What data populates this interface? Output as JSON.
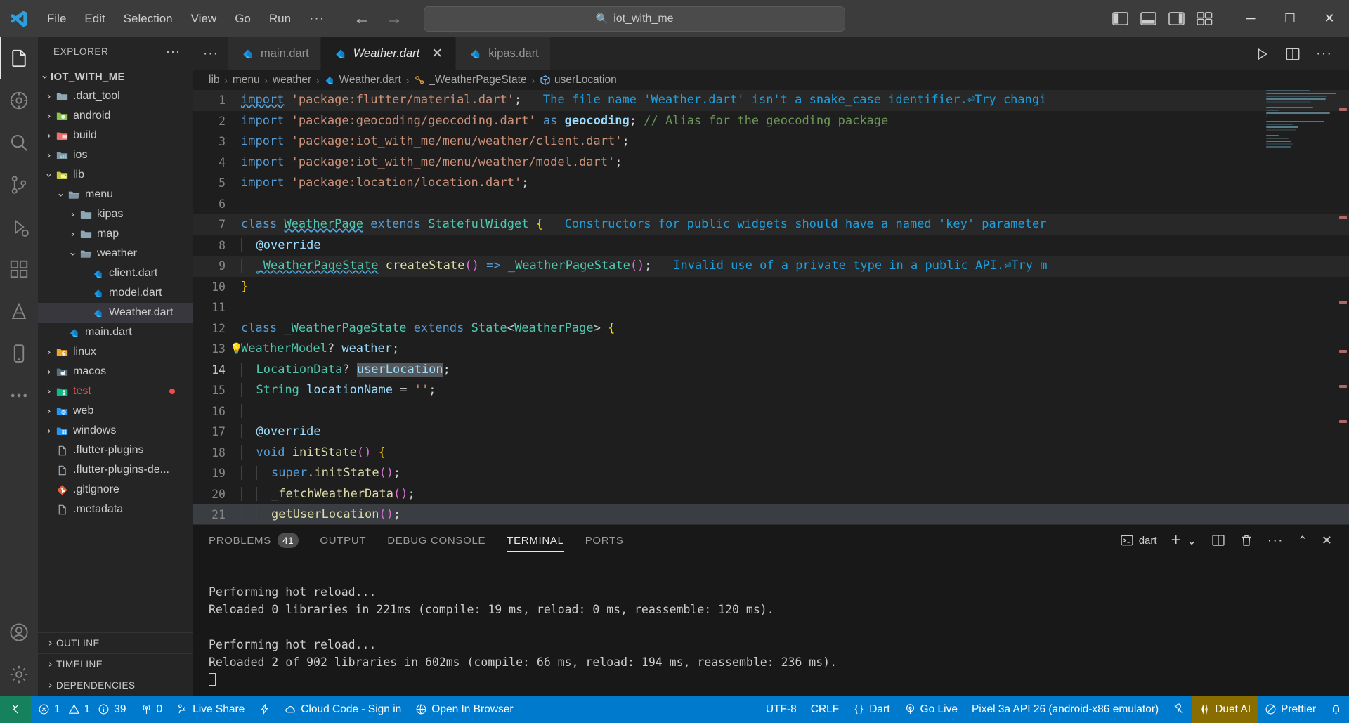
{
  "titlebar": {
    "menus": [
      "File",
      "Edit",
      "Selection",
      "View",
      "Go",
      "Run"
    ],
    "overflow_label": "···",
    "back_label": "←",
    "forward_label": "→",
    "quick_open_value": "iot_with_me",
    "minimize_label": "─",
    "maximize_label": "☐",
    "close_label": "✕"
  },
  "activitybar": {
    "items": [
      {
        "name": "explorer",
        "active": true
      },
      {
        "name": "source-control-graph",
        "active": false
      },
      {
        "name": "search",
        "active": false
      },
      {
        "name": "source-control",
        "active": false
      },
      {
        "name": "run-and-debug",
        "active": false
      },
      {
        "name": "extensions",
        "active": false
      },
      {
        "name": "testing",
        "active": false
      },
      {
        "name": "remote-explorer",
        "active": false
      },
      {
        "name": "more",
        "active": false
      }
    ],
    "bottom": [
      {
        "name": "accounts"
      },
      {
        "name": "manage-settings"
      }
    ]
  },
  "sidebar": {
    "title": "EXPLORER",
    "more_label": "···",
    "root": "IOT_WITH_ME",
    "tree": [
      {
        "label": ".dart_tool",
        "depth": 1,
        "type": "folder",
        "icon": "folder-default",
        "expanded": false
      },
      {
        "label": "android",
        "depth": 1,
        "type": "folder",
        "icon": "folder-android",
        "expanded": false
      },
      {
        "label": "build",
        "depth": 1,
        "type": "folder",
        "icon": "folder-build",
        "expanded": false
      },
      {
        "label": "ios",
        "depth": 1,
        "type": "folder",
        "icon": "folder-ios",
        "expanded": false
      },
      {
        "label": "lib",
        "depth": 1,
        "type": "folder",
        "icon": "folder-lib",
        "expanded": true
      },
      {
        "label": "menu",
        "depth": 2,
        "type": "folder",
        "icon": "folder-open",
        "expanded": true
      },
      {
        "label": "kipas",
        "depth": 3,
        "type": "folder",
        "icon": "folder-default",
        "expanded": false
      },
      {
        "label": "map",
        "depth": 3,
        "type": "folder",
        "icon": "folder-default",
        "expanded": false
      },
      {
        "label": "weather",
        "depth": 3,
        "type": "folder",
        "icon": "folder-open",
        "expanded": true
      },
      {
        "label": "client.dart",
        "depth": 4,
        "type": "file",
        "icon": "dart-icon"
      },
      {
        "label": "model.dart",
        "depth": 4,
        "type": "file",
        "icon": "dart-icon"
      },
      {
        "label": "Weather.dart",
        "depth": 4,
        "type": "file",
        "icon": "dart-icon",
        "selected": true
      },
      {
        "label": "main.dart",
        "depth": 2,
        "type": "file",
        "icon": "dart-icon"
      },
      {
        "label": "linux",
        "depth": 1,
        "type": "folder",
        "icon": "folder-linux",
        "expanded": false
      },
      {
        "label": "macos",
        "depth": 1,
        "type": "folder",
        "icon": "folder-macos",
        "expanded": false
      },
      {
        "label": "test",
        "depth": 1,
        "type": "folder",
        "icon": "folder-test",
        "expanded": false,
        "error": true
      },
      {
        "label": "web",
        "depth": 1,
        "type": "folder",
        "icon": "folder-web",
        "expanded": false
      },
      {
        "label": "windows",
        "depth": 1,
        "type": "folder",
        "icon": "folder-windows",
        "expanded": false
      },
      {
        "label": ".flutter-plugins",
        "depth": 1,
        "type": "file",
        "icon": "file-plain"
      },
      {
        "label": ".flutter-plugins-de...",
        "depth": 1,
        "type": "file",
        "icon": "file-plain"
      },
      {
        "label": ".gitignore",
        "depth": 1,
        "type": "file",
        "icon": "git-icon"
      },
      {
        "label": ".metadata",
        "depth": 1,
        "type": "file",
        "icon": "file-plain"
      }
    ],
    "sections": [
      "OUTLINE",
      "TIMELINE",
      "DEPENDENCIES"
    ]
  },
  "tabs": {
    "overflow_label": "···",
    "items": [
      {
        "label": "main.dart",
        "active": false,
        "italic": false,
        "closable": false
      },
      {
        "label": "Weather.dart",
        "active": true,
        "italic": true,
        "closable": true,
        "close_label": "✕"
      },
      {
        "label": "kipas.dart",
        "active": false,
        "italic": false,
        "closable": false
      }
    ],
    "actions": [
      "run-button",
      "split-editor-button",
      "more-actions"
    ],
    "more_label": "···"
  },
  "breadcrumb": [
    {
      "label": "lib",
      "icon": null
    },
    {
      "label": "menu",
      "icon": null
    },
    {
      "label": "weather",
      "icon": null
    },
    {
      "label": "Weather.dart",
      "icon": "dart-icon"
    },
    {
      "label": "_WeatherPageState",
      "icon": "class-icon"
    },
    {
      "label": "userLocation",
      "icon": "field-icon"
    }
  ],
  "breadcrumb_separator": "›",
  "editor": {
    "lines": [
      {
        "n": 1,
        "text": "import 'package:flutter/material.dart';"
      },
      {
        "n": 2,
        "text": "import 'package:geocoding/geocoding.dart' as geocoding; // Alias for the geocoding package"
      },
      {
        "n": 3,
        "text": "import 'package:iot_with_me/menu/weather/client.dart';"
      },
      {
        "n": 4,
        "text": "import 'package:iot_with_me/menu/weather/model.dart';"
      },
      {
        "n": 5,
        "text": "import 'package:location/location.dart';"
      },
      {
        "n": 6,
        "text": ""
      },
      {
        "n": 7,
        "text": "class WeatherPage extends StatefulWidget {"
      },
      {
        "n": 8,
        "text": "  @override"
      },
      {
        "n": 9,
        "text": "  _WeatherPageState createState() => _WeatherPageState();"
      },
      {
        "n": 10,
        "text": "}"
      },
      {
        "n": 11,
        "text": ""
      },
      {
        "n": 12,
        "text": "class _WeatherPageState extends State<WeatherPage> {"
      },
      {
        "n": 13,
        "text": "  WeatherModel? weather;"
      },
      {
        "n": 14,
        "text": "  LocationData? userLocation;"
      },
      {
        "n": 15,
        "text": "  String locationName = '';"
      },
      {
        "n": 16,
        "text": ""
      },
      {
        "n": 17,
        "text": "  @override"
      },
      {
        "n": 18,
        "text": "  void initState() {"
      },
      {
        "n": 19,
        "text": "    super.initState();"
      },
      {
        "n": 20,
        "text": "    _fetchWeatherData();"
      },
      {
        "n": 21,
        "text": "    getUserLocation();"
      }
    ],
    "inline_diagnostics": [
      {
        "line": 1,
        "text": "The file name 'Weather.dart' isn't a snake_case identifier.⏎Try changi"
      },
      {
        "line": 7,
        "text": "Constructors for public widgets should have a named 'key' parameter"
      },
      {
        "line": 9,
        "text": "Invalid use of a private type in a public API.⏎Try m"
      }
    ],
    "cursor_line": 14,
    "selected_token": "userLocation"
  },
  "panel": {
    "tabs": [
      {
        "label": "PROBLEMS",
        "badge": "41",
        "active": false
      },
      {
        "label": "OUTPUT",
        "badge": null,
        "active": false
      },
      {
        "label": "DEBUG CONSOLE",
        "badge": null,
        "active": false
      },
      {
        "label": "TERMINAL",
        "badge": null,
        "active": true
      },
      {
        "label": "PORTS",
        "badge": null,
        "active": false
      }
    ],
    "terminal_selector": "dart",
    "new_terminal_label": "+",
    "dropdown_label": "⌄",
    "more_label": "···",
    "collapse_label": "⌃",
    "close_label": "✕",
    "terminal_output": [
      "Performing hot reload...",
      "Reloaded 0 libraries in 221ms (compile: 19 ms, reload: 0 ms, reassemble: 120 ms).",
      "",
      "Performing hot reload...",
      "Reloaded 2 of 902 libraries in 602ms (compile: 66 ms, reload: 194 ms, reassemble: 236 ms)."
    ]
  },
  "statusbar": {
    "left": [
      {
        "name": "remote-indicator",
        "icon": "remote-icon",
        "label": ""
      },
      {
        "name": "problems",
        "icon": "error-icon",
        "label": "1",
        "icon2": "warning-icon",
        "label2": "1",
        "icon3": "info-icon",
        "label3": "39"
      },
      {
        "name": "ports",
        "icon": "radio-tower-icon",
        "label": "0"
      },
      {
        "name": "live-share",
        "icon": "live-share-icon",
        "label": "Live Share"
      },
      {
        "name": "flutter-inspector",
        "icon": "zap-icon",
        "label": ""
      },
      {
        "name": "cloud-code",
        "icon": "cloud-icon",
        "label": "Cloud Code - Sign in"
      },
      {
        "name": "open-in-browser",
        "icon": "globe-icon",
        "label": "Open In Browser"
      }
    ],
    "right": [
      {
        "name": "encoding",
        "label": "UTF-8"
      },
      {
        "name": "eol",
        "label": "CRLF"
      },
      {
        "name": "language-mode",
        "icon": "brackets-icon",
        "label": "Dart"
      },
      {
        "name": "go-live",
        "icon": "broadcast-icon",
        "label": "Go Live"
      },
      {
        "name": "device-selector",
        "label": "Pixel 3a API 26 (android-x86 emulator)"
      },
      {
        "name": "no-screencast",
        "icon": "screencast-off-icon",
        "label": ""
      },
      {
        "name": "duet-ai",
        "icon": "duet-icon",
        "label": "Duet AI"
      },
      {
        "name": "prettier",
        "icon": "prettier-icon",
        "label": "Prettier"
      },
      {
        "name": "notifications",
        "icon": "bell-icon",
        "label": ""
      }
    ]
  },
  "colors": {
    "accent": "#007acc",
    "titlebar": "#3c3c3c",
    "activitybar": "#333333",
    "sidebar": "#252526",
    "editor": "#1e1e1e",
    "panel": "#181818",
    "remote": "#16825d",
    "duet": "#8a6d00",
    "error": "#f14c4c"
  }
}
